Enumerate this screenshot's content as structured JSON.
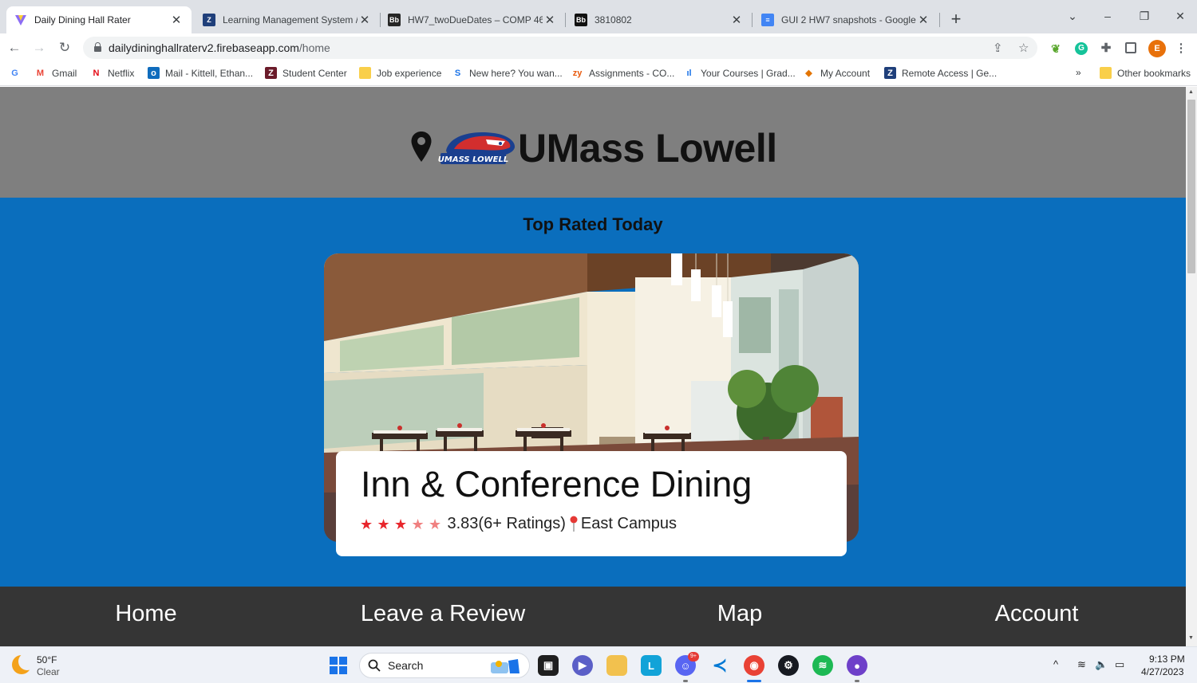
{
  "browser": {
    "tabs": [
      {
        "title": "Daily Dining Hall Rater",
        "favicon": "vite-icon",
        "active": true
      },
      {
        "title": "Learning Management System / (",
        "favicon": "umass-icon"
      },
      {
        "title": "HW7_twoDueDates – COMP 462(",
        "favicon": "blackboard-icon"
      },
      {
        "title": "3810802",
        "favicon": "blackboard-icon"
      },
      {
        "title": "GUI 2 HW7 snapshots - Google D",
        "favicon": "docs-icon"
      }
    ],
    "url_host": "dailydininghallraterv2.firebaseapp.com",
    "url_path": "/home",
    "profile_initial": "E",
    "bookmarks": [
      {
        "label": "Gmail"
      },
      {
        "label": "Netflix"
      },
      {
        "label": "Mail - Kittell, Ethan..."
      },
      {
        "label": "Student Center"
      },
      {
        "label": "Job experience"
      },
      {
        "label": "New here? You wan..."
      },
      {
        "label": "Assignments - CO..."
      },
      {
        "label": "Your Courses | Grad..."
      },
      {
        "label": "My Account"
      },
      {
        "label": "Remote Access | Ge..."
      }
    ],
    "bookmarks_overflow": "»",
    "other_bookmarks": "Other bookmarks"
  },
  "page": {
    "site_title": "UMass Lowell",
    "logo_text": "UMASS LOWELL",
    "section_title": "Top Rated Today",
    "featured": {
      "name": "Inn & Conference Dining",
      "rating_stars": 3.83,
      "rating_text": "3.83(6+ Ratings)",
      "location": "East Campus"
    },
    "nav": [
      {
        "label": "Home"
      },
      {
        "label": "Leave a Review"
      },
      {
        "label": "Map"
      },
      {
        "label": "Account"
      }
    ]
  },
  "taskbar": {
    "weather_temp": "50°F",
    "weather_desc": "Clear",
    "search_label": "Search",
    "discord_badge": "9+",
    "time": "9:13 PM",
    "date": "4/27/2023"
  },
  "colors": {
    "header_gray": "#7f7f7f",
    "page_blue": "#0a6ebd",
    "nav_dark": "#353535",
    "star_red": "#e8262c"
  }
}
